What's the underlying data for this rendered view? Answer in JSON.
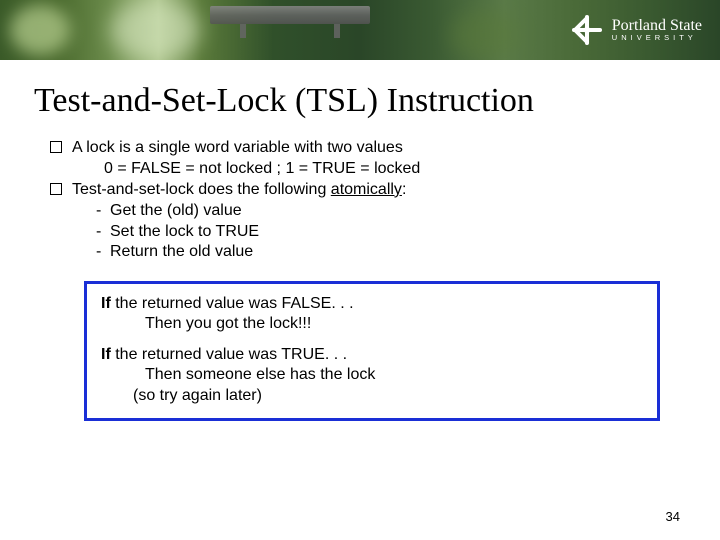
{
  "logo": {
    "line1": "Portland State",
    "line2": "UNIVERSITY"
  },
  "title": "Test-and-Set-Lock (TSL) Instruction",
  "bullets": {
    "b1": "A lock is a single word variable with two values",
    "b1_sub": "0 = FALSE = not locked ; 1 = TRUE = locked",
    "b2_pre": "Test-and-set-lock does the following ",
    "b2_em": "atomically",
    "b2_post": ":",
    "d1": "Get the (old) value",
    "d2": "Set the lock to TRUE",
    "d3": "Return the old value"
  },
  "box": {
    "p1_if": "If",
    "p1_rest": " the returned value was FALSE. . .",
    "p1_then": "Then you got the lock!!!",
    "p2_if": "If",
    "p2_rest": " the returned value was TRUE. . .",
    "p2_then": "Then someone else has the lock",
    "p2_note": "(so try again later)"
  },
  "page": "34"
}
